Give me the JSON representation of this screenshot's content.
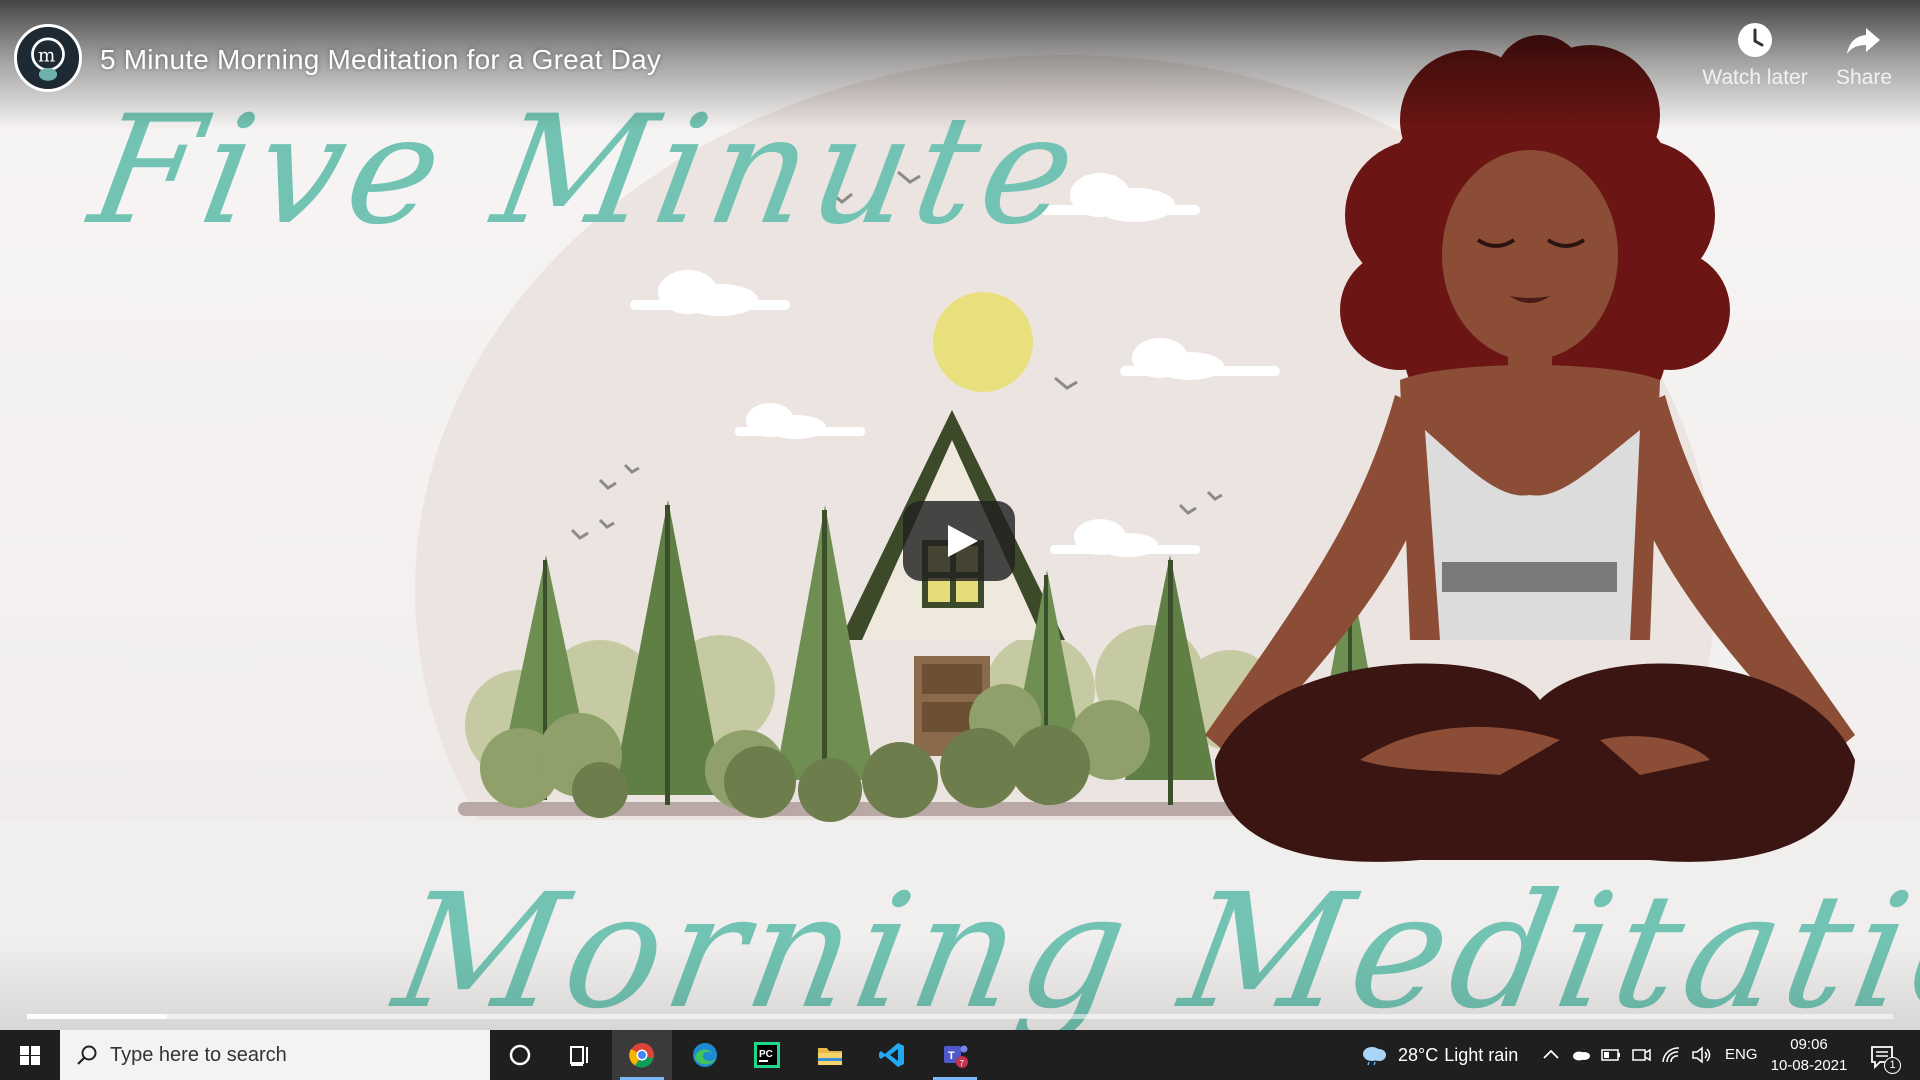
{
  "video": {
    "title": "5 Minute Morning Meditation for a Great Day",
    "thumbnail_text_top": "Five Minute",
    "thumbnail_text_bottom": "Morning Meditation",
    "progress": 0.075,
    "actions": {
      "watch_later": "Watch later",
      "share": "Share"
    },
    "icons": {
      "channel": "channel-avatar",
      "play": "play-icon",
      "watch_later": "clock-icon",
      "share": "share-arrow-icon"
    }
  },
  "taskbar": {
    "search_placeholder": "Type here to search",
    "apps": [
      "cortana-icon",
      "task-view-icon",
      "chrome-icon",
      "edge-icon",
      "pycharm-icon",
      "file-explorer-icon",
      "vscode-icon",
      "teams-icon"
    ],
    "weather": {
      "temperature": "28°C",
      "condition": "Light rain"
    },
    "language": "ENG",
    "time": "09:06",
    "date": "10-08-2021",
    "notification_count": "1"
  },
  "colors": {
    "script_teal": "#72c3b3",
    "taskbar": "#1f1f1f",
    "accent": "#7cb8ff"
  }
}
